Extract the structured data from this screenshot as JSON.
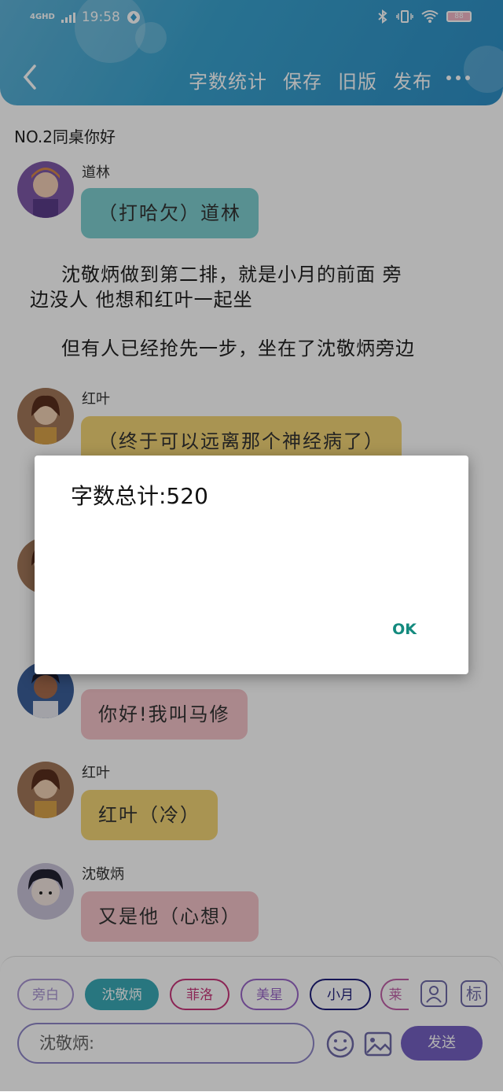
{
  "status_bar": {
    "network": "4GHD",
    "time": "19:58",
    "battery": "88"
  },
  "nav": {
    "actions": [
      "字数统计",
      "保存",
      "旧版",
      "发布"
    ]
  },
  "chat_title": "NO.2同桌你好",
  "messages": [
    {
      "sender": "道林",
      "text": "（打哈欠）道林",
      "color": "#7fcfd0"
    },
    {
      "narration": "沈敬炳做到第二排，就是小月的前面 旁",
      "narration2": "边没人 他想和红叶一起坐"
    },
    {
      "narration": "但有人已经抢先一步，坐在了沈敬炳旁边"
    },
    {
      "sender": "红叶",
      "text": "（终于可以远离那个神经病了）",
      "color": "#f2d476"
    },
    {
      "sender": "",
      "text": "你好!我叫马修",
      "color": "#f4c3c9"
    },
    {
      "sender": "红叶",
      "text": "红叶（冷）",
      "color": "#f2d476"
    },
    {
      "sender": "沈敬炳",
      "text": "又是他（心想）",
      "color": "#f4c3c9"
    }
  ],
  "dialog": {
    "message": "字数总计:520",
    "ok_label": "OK"
  },
  "bottom": {
    "chips": [
      {
        "label": "旁白",
        "color": "#a894d2"
      },
      {
        "label": "沈敬炳",
        "color": "#3aaab6"
      },
      {
        "label": "菲洛",
        "color": "#c8357a"
      },
      {
        "label": "美星",
        "color": "#9a66c8"
      },
      {
        "label": "小月",
        "color": "#1f1f7a"
      },
      {
        "label": "莱",
        "color": "#c060a8"
      }
    ],
    "input_value": "沈敬炳:",
    "send_label": "发送"
  }
}
